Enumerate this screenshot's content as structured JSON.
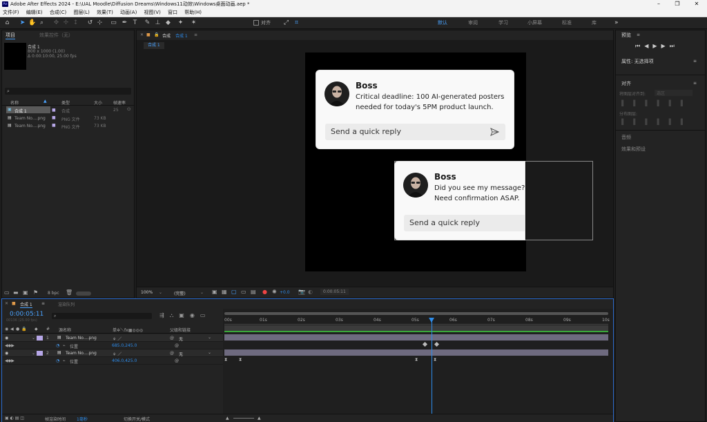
{
  "window": {
    "app_icon": "Ae",
    "title": "Adobe After Effects 2024 - E:\\UAL Moodle\\Diffusion Dreams\\Windows11动效\\Windows桌面动画.aep *",
    "min": "–",
    "max": "❐",
    "close": "✕"
  },
  "menu": [
    "文件(F)",
    "编辑(E)",
    "合成(C)",
    "图层(L)",
    "效果(T)",
    "动画(A)",
    "视图(V)",
    "窗口",
    "帮助(H)"
  ],
  "toolbar": {
    "align_label": "对齐",
    "workspaces": [
      "默认",
      "审阅",
      "学习",
      "小屏幕",
      "标准",
      "库"
    ],
    "more": "»"
  },
  "project": {
    "tab": "项目",
    "tab2": "效果控件（无）",
    "comp_name": "合成 1",
    "comp_info1": "800 x 1000 (1.00)",
    "comp_info2": "Δ 0:00:10:00, 25.00 fps",
    "columns": [
      "名称",
      "类型",
      "大小",
      "帧速率"
    ],
    "items": [
      {
        "name": "合成 1",
        "type": "合成",
        "size": "",
        "fps": "25"
      },
      {
        "name": "Team No....png",
        "type": "PNG 文件",
        "size": "73 KB",
        "fps": ""
      },
      {
        "name": "Team No....png",
        "type": "PNG 文件",
        "size": "73 KB",
        "fps": ""
      }
    ],
    "bpc": "8 bpc"
  },
  "composition": {
    "tab": "合成",
    "tab_name": "合成 1",
    "breadcrumb": "合成 1",
    "zoom": "100%",
    "quality": "(完整)",
    "exposure": "+0.0",
    "timecode": "0:00:05:11"
  },
  "notification1": {
    "name": "Boss",
    "message": "Critical deadline: 100 AI-generated posters needed for today's 5PM product launch.",
    "reply_placeholder": "Send a quick reply"
  },
  "notification2": {
    "name": "Boss",
    "message": "Did you see my message? Need confirmation ASAP.",
    "reply_placeholder": "Send a quick reply"
  },
  "right_panel": {
    "preview": "预览",
    "properties": "属性: 无选择项",
    "align": "对齐",
    "align_to": "将图层对齐到:",
    "align_to_value": "选区",
    "distribute": "分布图层:",
    "audio": "音频",
    "effects": "效果和预设"
  },
  "timeline": {
    "tab": "合成 1",
    "tab2": "渲染队列",
    "timecode": "0:00:05:11",
    "frames": "00136 (25.00 fps)",
    "columns": {
      "source": "源名称",
      "switches": "单✲＼fx▦◎◎◎",
      "parent": "父级和链接"
    },
    "ruler": [
      "00s",
      "01s",
      "02s",
      "03s",
      "04s",
      "05s",
      "06s",
      "07s",
      "08s",
      "09s",
      "10s"
    ],
    "layers": [
      {
        "num": "1",
        "name": "Team No....png",
        "parent": "无",
        "prop": "位置",
        "value": "685.0,245.0"
      },
      {
        "num": "2",
        "name": "Team No....png",
        "parent": "无",
        "prop": "位置",
        "value": "406.0,425.0"
      }
    ],
    "footer_left": "帧渲染时间",
    "footer_ms": "1毫秒",
    "footer_mode": "切换开关/模式"
  }
}
